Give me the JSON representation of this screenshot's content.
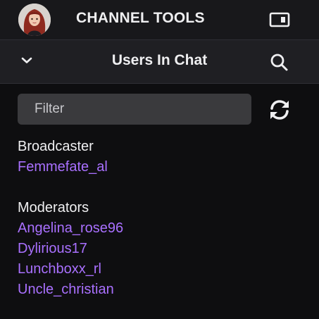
{
  "channel_bar": {
    "title": "CHANNEL TOOLS",
    "avatar_icon": "profile-avatar",
    "toggle_icon": "panel-collapse-icon"
  },
  "chat_header": {
    "title": "Users In Chat",
    "collapse_icon": "chevron-down-icon",
    "search_icon": "search-icon"
  },
  "filter": {
    "placeholder": "Filter",
    "value": "",
    "refresh_icon": "refresh-icon"
  },
  "broadcaster": {
    "label": "Broadcaster",
    "users": [
      "Femmefate_al"
    ]
  },
  "moderators": {
    "label": "Moderators",
    "users": [
      "Angelina_rose96",
      "Dylirious17",
      "Lunchboxx_rl",
      "Uncle_christian"
    ]
  },
  "colors": {
    "background": "#0e0e10",
    "header": "#1f1f23",
    "input": "#3a3a3d",
    "username": "#a970ff",
    "text": "#efeff1"
  }
}
